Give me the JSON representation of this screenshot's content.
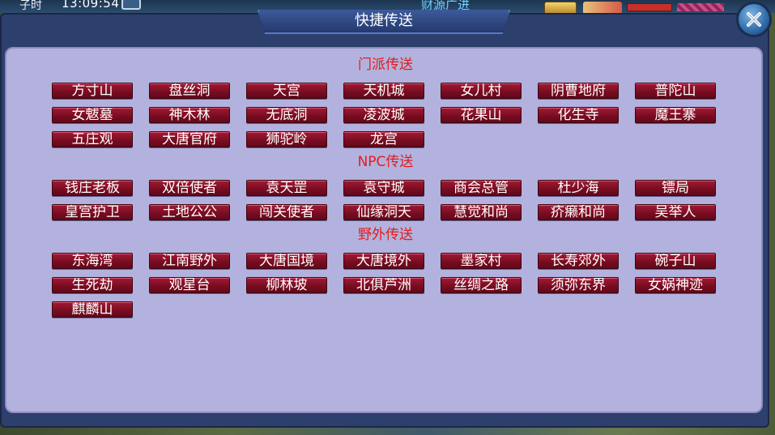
{
  "hud": {
    "time_label": "子时",
    "time": "13:09:54",
    "news": "财源广进"
  },
  "window": {
    "title": "快捷传送"
  },
  "sections": [
    {
      "title": "门派传送",
      "buttons": [
        "方寸山",
        "盘丝洞",
        "天宫",
        "天机城",
        "女儿村",
        "阴曹地府",
        "普陀山",
        "女魃墓",
        "神木林",
        "无底洞",
        "凌波城",
        "花果山",
        "化生寺",
        "魔王寨",
        "五庄观",
        "大唐官府",
        "狮驼岭",
        "龙宫"
      ]
    },
    {
      "title": "NPC传送",
      "buttons": [
        "钱庄老板",
        "双倍使者",
        "袁天罡",
        "袁守城",
        "商会总管",
        "杜少海",
        "镖局",
        "皇宫护卫",
        "土地公公",
        "闯关使者",
        "仙缘洞天",
        "慧觉和尚",
        "疥癞和尚",
        "吴举人"
      ]
    },
    {
      "title": "野外传送",
      "buttons": [
        "东海湾",
        "江南野外",
        "大唐国境",
        "大唐境外",
        "墨家村",
        "长寿郊外",
        "碗子山",
        "生死劫",
        "观星台",
        "柳林坡",
        "北俱芦洲",
        "丝绸之路",
        "须弥东界",
        "女娲神迹",
        "麒麟山"
      ]
    }
  ],
  "icons": {
    "close": "close-icon"
  },
  "colors": {
    "panel_bg": "#b3b2de",
    "section_title": "#e21b1b",
    "button_bg": "#7a0d22",
    "frame": "#2d3f6c"
  }
}
